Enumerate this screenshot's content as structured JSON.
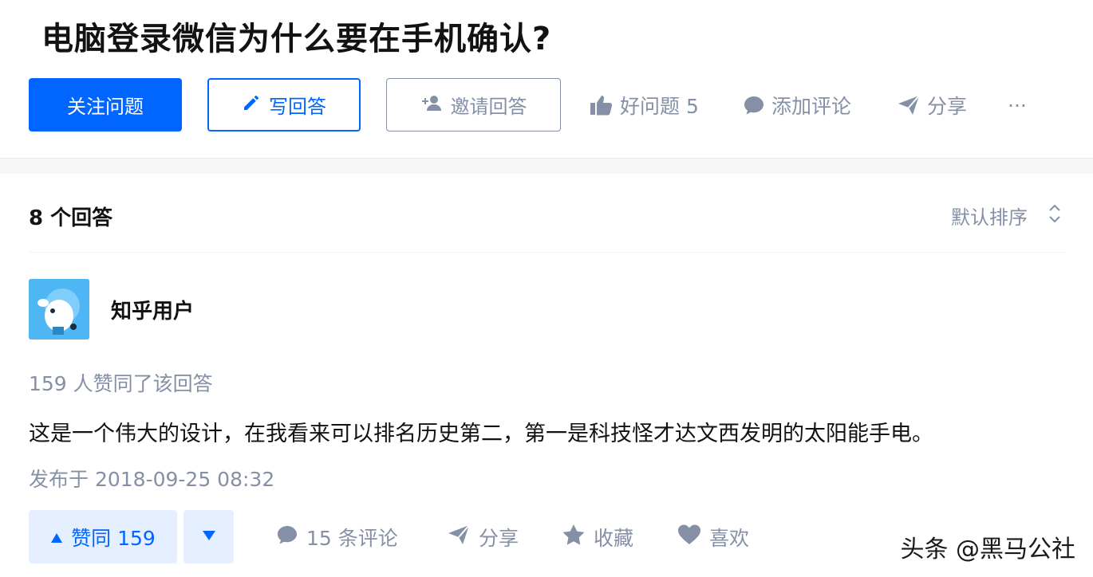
{
  "question": {
    "title": "电脑登录微信为什么要在手机确认?"
  },
  "toolbar": {
    "follow_label": "关注问题",
    "write_label": "写回答",
    "invite_label": "邀请回答",
    "good_question_label": "好问题 5",
    "comment_label": "添加评论",
    "share_label": "分享",
    "more_label": "···"
  },
  "answers": {
    "count_label": "8 个回答",
    "sort_label": "默认排序"
  },
  "answer": {
    "author": "知乎用户",
    "votes_meta": "159 人赞同了该回答",
    "content": "这是一个伟大的设计，在我看来可以排名历史第二，第一是科技怪才达文西发明的太阳能手电。",
    "published": "发布于 2018-09-25 08:32",
    "vote_up_label": "赞同 159",
    "comments_label": "15 条评论",
    "share_label": "分享",
    "collect_label": "收藏",
    "like_label": "喜欢"
  },
  "watermark": "头条 @黑马公社",
  "colors": {
    "brand_blue": "#0066ff",
    "muted_gray": "#8590a6",
    "vote_bg": "#e5efff",
    "avatar_bg": "#4fb6f4"
  },
  "icons": [
    "pencil-icon",
    "add-user-icon",
    "thumb-up-icon",
    "comment-icon",
    "paper-plane-icon",
    "more-icon",
    "sort-chevrons-icon",
    "triangle-up-icon",
    "triangle-down-icon",
    "star-icon",
    "heart-icon"
  ]
}
